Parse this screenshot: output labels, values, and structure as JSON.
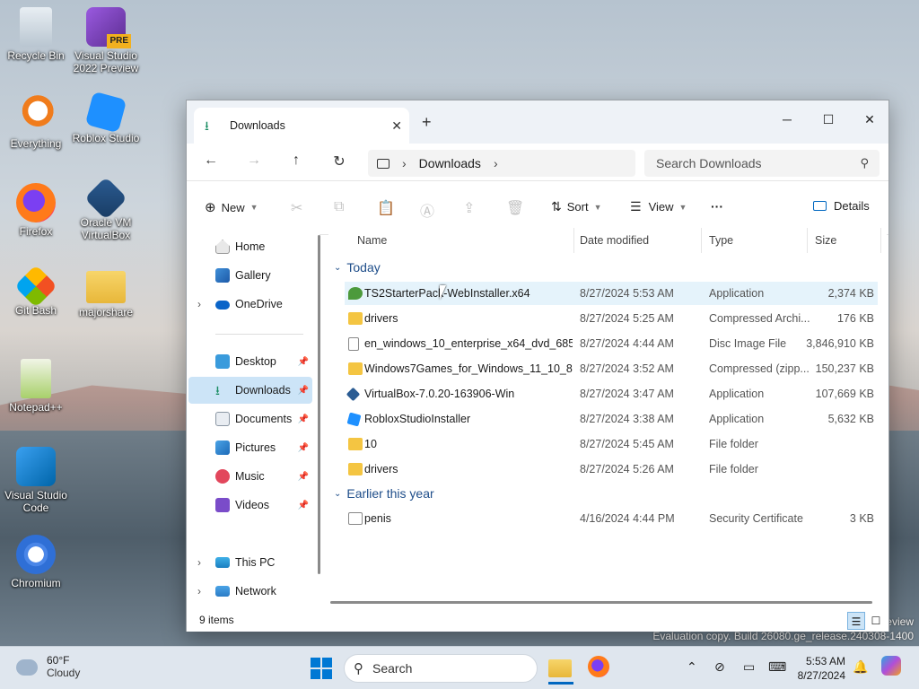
{
  "desktop": {
    "icons": [
      {
        "label": "Recycle Bin"
      },
      {
        "label": "Visual Studio 2022 Preview",
        "badge": "PRE"
      },
      {
        "label": "Everything"
      },
      {
        "label": "Roblox Studio"
      },
      {
        "label": "Firefox"
      },
      {
        "label": "Oracle VM VirtualBox"
      },
      {
        "label": "Git Bash"
      },
      {
        "label": "majorshare"
      },
      {
        "label": "Notepad++"
      },
      {
        "label": "Visual Studio Code"
      },
      {
        "label": "Chromium"
      }
    ],
    "watermark_line1": "review",
    "watermark_line2": "Evaluation copy. Build 26080.ge_release.240308-1400"
  },
  "window": {
    "tab_title": "Downloads",
    "tab_icon": "download-icon",
    "new_tab": "+",
    "breadcrumb": [
      "Downloads"
    ],
    "search_placeholder": "Search Downloads",
    "toolbar": {
      "new_label": "New",
      "sort_label": "Sort",
      "view_label": "View",
      "more_label": "···",
      "details_label": "Details"
    },
    "sidebar": {
      "items": [
        {
          "label": "Home"
        },
        {
          "label": "Gallery"
        },
        {
          "label": "OneDrive"
        },
        {
          "label": "Desktop"
        },
        {
          "label": "Downloads"
        },
        {
          "label": "Documents"
        },
        {
          "label": "Pictures"
        },
        {
          "label": "Music"
        },
        {
          "label": "Videos"
        },
        {
          "label": "This PC"
        },
        {
          "label": "Network"
        }
      ]
    },
    "columns": {
      "name": "Name",
      "date": "Date modified",
      "type": "Type",
      "size": "Size"
    },
    "groups": {
      "today": {
        "label": "Today",
        "files": [
          {
            "name": "TS2StarterPack-WebInstaller.x64",
            "date": "8/27/2024 5:53 AM",
            "type": "Application",
            "size": "2,374 KB"
          },
          {
            "name": "drivers",
            "date": "8/27/2024 5:25 AM",
            "type": "Compressed Archi...",
            "size": "176 KB"
          },
          {
            "name": "en_windows_10_enterprise_x64_dvd_6851...",
            "date": "8/27/2024 4:44 AM",
            "type": "Disc Image File",
            "size": "3,846,910 KB"
          },
          {
            "name": "Windows7Games_for_Windows_11_10_8",
            "date": "8/27/2024 3:52 AM",
            "type": "Compressed (zipp...",
            "size": "150,237 KB"
          },
          {
            "name": "VirtualBox-7.0.20-163906-Win",
            "date": "8/27/2024 3:47 AM",
            "type": "Application",
            "size": "107,669 KB"
          },
          {
            "name": "RobloxStudioInstaller",
            "date": "8/27/2024 3:38 AM",
            "type": "Application",
            "size": "5,632 KB"
          },
          {
            "name": "10",
            "date": "8/27/2024 5:45 AM",
            "type": "File folder",
            "size": ""
          },
          {
            "name": "drivers",
            "date": "8/27/2024 5:26 AM",
            "type": "File folder",
            "size": ""
          }
        ]
      },
      "earlier": {
        "label": "Earlier this year",
        "files": [
          {
            "name": "penis",
            "date": "4/16/2024 4:44 PM",
            "type": "Security Certificate",
            "size": "3 KB"
          }
        ]
      }
    },
    "status": {
      "item_count": "9 items"
    }
  },
  "taskbar": {
    "weather_temp": "60°F",
    "weather_desc": "Cloudy",
    "search_label": "Search",
    "time": "5:53 AM",
    "date": "8/27/2024"
  },
  "colors": {
    "accent": "#0067c0",
    "selected": "#cce4f7",
    "hover": "#e5f3fb",
    "folder": "#f4c542"
  }
}
